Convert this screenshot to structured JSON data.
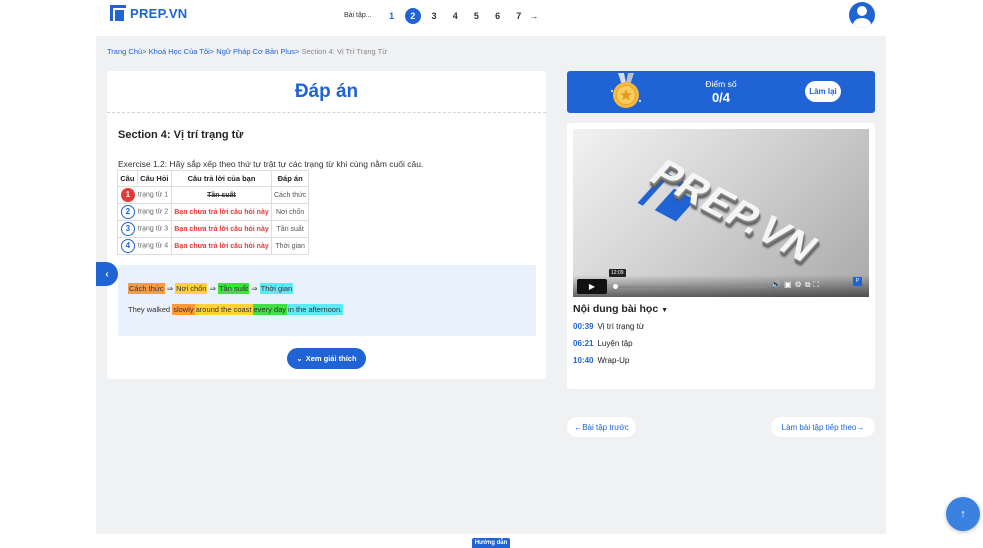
{
  "header": {
    "logo_text": "PREP.VN",
    "pager_label": "Bài tập...",
    "pages": [
      "1",
      "2",
      "3",
      "4",
      "5",
      "6",
      "7"
    ],
    "active_page": "2",
    "next_arrow": "→"
  },
  "breadcrumb": {
    "items": [
      "Trang Chủ",
      "Khoá Học Của Tôi",
      "Ngữ Pháp Cơ Bản Plus"
    ],
    "current": "Section 4: Vị Trí Trạng Từ",
    "sep": ">"
  },
  "answer_card": {
    "title": "Đáp án",
    "section_title": "Section 4: Vị trí trạng từ",
    "exercise_text": "Exercise 1.2: Hãy sắp xếp theo thứ tự trật tự các trạng từ khi cùng nằm cuối câu.",
    "table": {
      "headers": [
        "Câu",
        "Câu Hỏi",
        "Câu trả lời của bạn",
        "Đáp án"
      ],
      "rows": [
        {
          "num": "1",
          "question": "trạng từ 1",
          "user_answer": "Tần suất",
          "correct": "Cách thức"
        },
        {
          "num": "2",
          "question": "trạng từ 2",
          "user_answer": "Bạn chưa trả lời câu hỏi này",
          "correct": "Nơi chốn"
        },
        {
          "num": "3",
          "question": "trạng từ 3",
          "user_answer": "Bạn chưa trả lời câu hỏi này",
          "correct": "Tần suất"
        },
        {
          "num": "4",
          "question": "trạng từ 4",
          "user_answer": "Bạn chưa trả lời câu hỏi này",
          "correct": "Thời gian"
        }
      ]
    },
    "order_chain": [
      "Cách thức",
      "Nơi chốn",
      "Tần suất",
      "Thời gian"
    ],
    "chain_arrow": "⇒",
    "sentence": {
      "prefix": "They walked",
      "parts": [
        "slowly",
        "around the coast",
        "every day",
        "in the afternoon."
      ]
    },
    "explain_button": "Xem giải thích"
  },
  "score": {
    "label": "Điểm số",
    "value": "0/4",
    "retry_button": "Làm lại"
  },
  "lesson": {
    "video_time": "12:09",
    "video_logo": "PREP.VN",
    "title": "Nội dung bài học",
    "items": [
      {
        "time": "00:39",
        "label": "Vị trí trạng từ"
      },
      {
        "time": "06:21",
        "label": "Luyện tập"
      },
      {
        "time": "10:40",
        "label": "Wrap-Up"
      }
    ]
  },
  "nav": {
    "prev": "←Bài tập trước",
    "next": "Làm bài tập tiếp theo→"
  },
  "bottom_tab": "Hướng dẫn",
  "colors": {
    "primary": "#1f63d4",
    "wrong": "#e53935",
    "hl_manner": "#ff9a3c",
    "hl_place": "#ffd23c",
    "hl_frequency": "#3fe03f",
    "hl_time": "#5fe9f5"
  }
}
